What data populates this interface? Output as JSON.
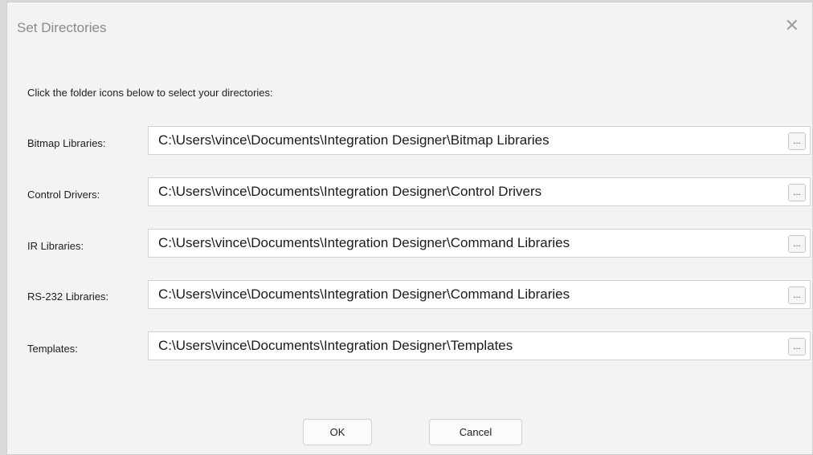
{
  "dialog": {
    "title": "Set Directories",
    "close_glyph": "✕",
    "instruction": "Click the folder icons below to select your directories:"
  },
  "rows": [
    {
      "label": "Bitmap Libraries:",
      "path": "C:\\Users\\vince\\Documents\\Integration Designer\\Bitmap Libraries",
      "browse_label": "..."
    },
    {
      "label": "Control Drivers:",
      "path": "C:\\Users\\vince\\Documents\\Integration Designer\\Control Drivers",
      "browse_label": "..."
    },
    {
      "label": "IR Libraries:",
      "path": "C:\\Users\\vince\\Documents\\Integration Designer\\Command Libraries",
      "browse_label": "..."
    },
    {
      "label": "RS-232 Libraries:",
      "path": "C:\\Users\\vince\\Documents\\Integration Designer\\Command Libraries",
      "browse_label": "..."
    },
    {
      "label": "Templates:",
      "path": "C:\\Users\\vince\\Documents\\Integration Designer\\Templates",
      "browse_label": "..."
    }
  ],
  "buttons": {
    "ok": "OK",
    "cancel": "Cancel"
  }
}
